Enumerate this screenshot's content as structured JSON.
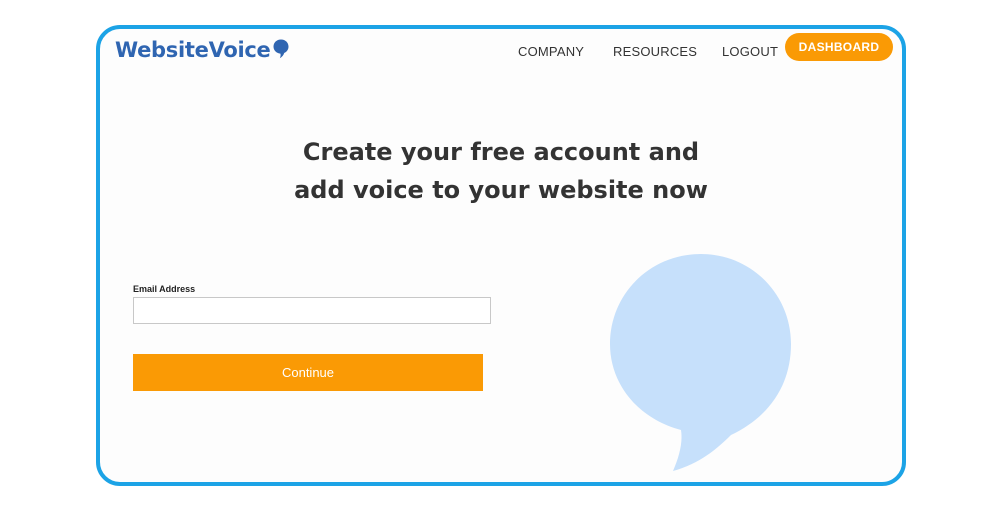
{
  "header": {
    "logo_text": "WebsiteVoice",
    "nav": {
      "company": "COMPANY",
      "resources": "RESOURCES",
      "logout": "LOGOUT",
      "dashboard": "DASHBOARD"
    }
  },
  "main": {
    "headline_line1": "Create your free account and",
    "headline_line2": "add voice to your website now",
    "email_label": "Email Address",
    "email_value": "",
    "email_placeholder": "",
    "continue_label": "Continue"
  },
  "colors": {
    "frame_border": "#1ca3e6",
    "brand_blue": "#2f65b1",
    "accent_orange": "#fa9a05",
    "bubble_light_blue": "#c6e0fb"
  },
  "icons": {
    "logo_icon": "speech-bubble-icon",
    "decoration": "speech-bubble-illustration"
  }
}
